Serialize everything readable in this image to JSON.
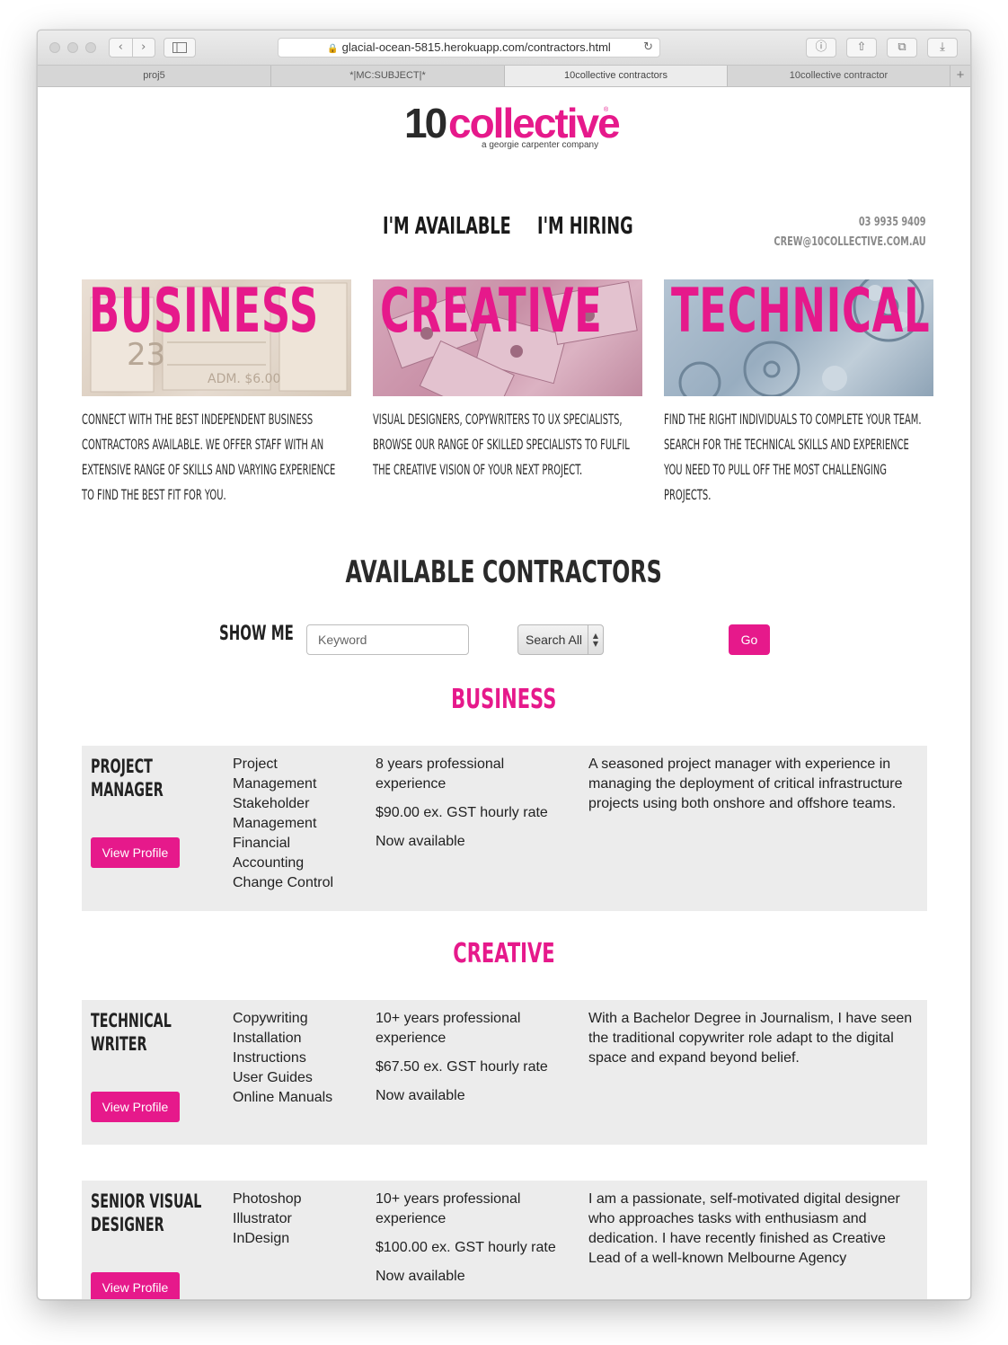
{
  "browser": {
    "url": "glacial-ocean-5815.herokuapp.com/contractors.html",
    "tabs": [
      "proj5",
      "*|MC:SUBJECT|*",
      "10collective contractors",
      "10collective contractor"
    ],
    "active_tab": 2
  },
  "site": {
    "logo_ten": "10",
    "logo_collective": "collective",
    "logo_registered": "®",
    "logo_tagline": "a georgie carpenter company",
    "nav": [
      "I'M AVAILABLE",
      "I'M HIRING"
    ],
    "phone": "03 9935 9409",
    "email": "CREW@10COLLECTIVE.COM.AU"
  },
  "categories": [
    {
      "title": "BUSINESS",
      "description": "CONNECT WITH THE BEST INDEPENDENT BUSINESS CONTRACTORS AVAILABLE. WE OFFER STAFF WITH AN EXTENSIVE RANGE OF SKILLS AND VARYING EXPERIENCE TO FIND THE BEST FIT FOR YOU."
    },
    {
      "title": "CREATIVE",
      "description": "VISUAL DESIGNERS, COPYWRITERS TO UX SPECIALISTS, BROWSE OUR RANGE OF SKILLED SPECIALISTS TO FULFIL THE CREATIVE VISION OF YOUR NEXT PROJECT."
    },
    {
      "title": "TECHNICAL",
      "description": "FIND THE RIGHT INDIVIDUALS TO COMPLETE YOUR TEAM. SEARCH FOR THE TECHNICAL SKILLS AND EXPERIENCE YOU NEED TO PULL OFF THE MOST CHALLENGING PROJECTS."
    }
  ],
  "contractors_heading": "AVAILABLE CONTRACTORS",
  "search": {
    "label": "SHOW ME",
    "keyword_placeholder": "Keyword",
    "select_value": "Search All",
    "go_label": "Go"
  },
  "sections": [
    {
      "title": "BUSINESS"
    },
    {
      "title": "CREATIVE"
    }
  ],
  "contractors": [
    {
      "role": "PROJECT MANAGER",
      "skills": [
        "Project Management",
        "Stakeholder Management",
        "Financial Accounting",
        "Change Control"
      ],
      "experience": "8 years professional experience",
      "rate": "$90.00 ex. GST hourly rate",
      "availability": "Now available",
      "bio": "A seasoned project manager with experience in managing the deployment of critical infrastructure projects using both onshore and offshore teams.",
      "button": "View Profile"
    },
    {
      "role": "TECHNICAL WRITER",
      "skills": [
        "Copywriting",
        "Installation Instructions",
        "User Guides",
        "Online Manuals"
      ],
      "experience": "10+ years professional experience",
      "rate": "$67.50 ex. GST hourly rate",
      "availability": "Now available",
      "bio": "With a Bachelor Degree in Journalism, I have seen the traditional copywriter role adapt to the digital space and expand beyond belief.",
      "button": "View Profile"
    },
    {
      "role": "SENIOR VISUAL DESIGNER",
      "skills": [
        "Photoshop",
        "Illustrator",
        "InDesign"
      ],
      "experience": "10+ years professional experience",
      "rate": "$100.00 ex. GST hourly rate",
      "availability": "Now available",
      "bio": "I am a passionate, self-motivated digital designer who approaches tasks with enthusiasm and dedication. I have recently finished as Creative Lead of a well-known Melbourne Agency",
      "button": "View Profile"
    }
  ],
  "colors": {
    "accent": "#e6198b",
    "card_bg": "#ececec",
    "text": "#222222"
  }
}
